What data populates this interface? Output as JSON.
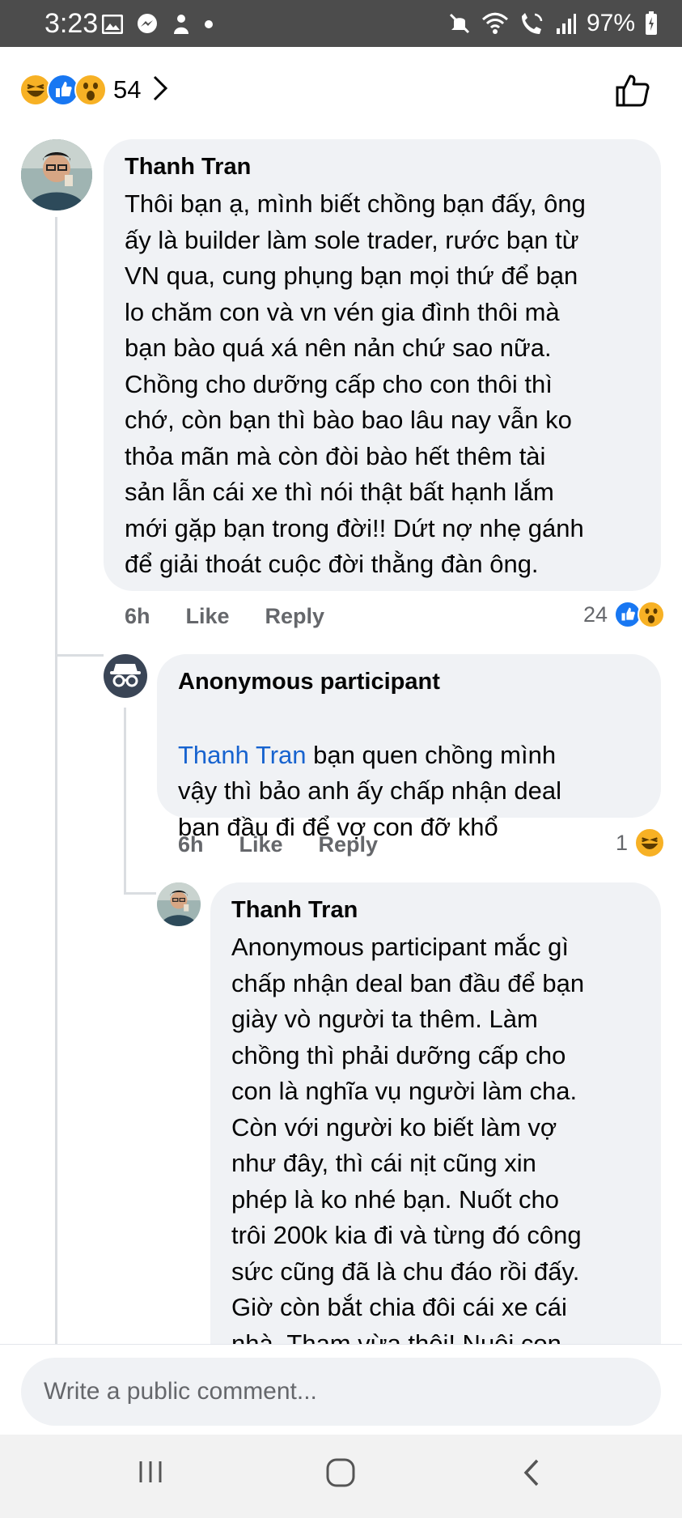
{
  "status_bar": {
    "time": "3:23",
    "battery_percent": "97%",
    "left_icons": [
      "gallery-icon",
      "messenger-icon",
      "notification-icon",
      "dot-icon"
    ],
    "right_icons": [
      "mute-icon",
      "wifi-icon",
      "wifi-calling-icon",
      "signal-icon",
      "battery-icon"
    ]
  },
  "reactions_header": {
    "count": "54",
    "reactions": [
      "haha",
      "like",
      "wow"
    ]
  },
  "comments": [
    {
      "author": "Thanh Tran",
      "text": "Thôi bạn ạ, mình biết chồng bạn đấy, ông\nấy là builder làm sole trader, rước bạn từ\nVN qua, cung phụng bạn mọi thứ để bạn\nlo chăm con và vn vén gia đình thôi mà\nbạn bào quá xá nên nản chứ sao nữa.\nChồng cho dưỡng cấp cho con thôi thì\nchớ, còn bạn thì bào bao lâu nay vẫn ko\nthỏa mãn mà còn đòi bào hết thêm tài\nsản lẫn cái xe thì nói thật bất hạnh lắm\nmới gặp bạn trong đời!! Dứt nợ nhẹ gánh\nđể giải thoát cuộc đời thằng đàn ông.",
      "time": "6h",
      "like_label": "Like",
      "reply_label": "Reply",
      "reaction_count": "24",
      "reactions": [
        "like",
        "wow"
      ]
    },
    {
      "author": "Anonymous participant",
      "mention": "Thanh Tran",
      "text_after_mention": " bạn quen chồng mình",
      "text_rest": "vậy thì bảo anh ấy chấp nhận deal\nban đầu đi để vợ con đỡ khổ",
      "time": "6h",
      "like_label": "Like",
      "reply_label": "Reply",
      "reaction_count": "1",
      "reactions": [
        "haha"
      ]
    },
    {
      "author": "Thanh Tran",
      "text": "Anonymous participant mắc gì\nchấp nhận deal ban đầu để bạn\ngiày vò người ta thêm. Làm\nchồng thì phải dưỡng cấp cho\ncon là nghĩa vụ người làm cha.\nCòn với người ko biết làm vợ\nnhư đây, thì cái nịt cũng xin\nphép là ko nhé bạn. Nuốt cho\ntrôi 200k kia đi và từng đó công\nsức cũng đã là chu đáo rồi đấy.\nGiờ còn bắt chia đôi cái xe cái\nnhà. Tham vừa thôi! Nuôi con"
    }
  ],
  "composer": {
    "placeholder": "Write a public comment..."
  },
  "colors": {
    "status_bar": "#4c4c4c",
    "bubble": "#f0f2f5",
    "mention": "#1763cf",
    "meta": "#65676b",
    "like_blue": "#1877f2",
    "emoji_yellow": "#f7b125"
  }
}
